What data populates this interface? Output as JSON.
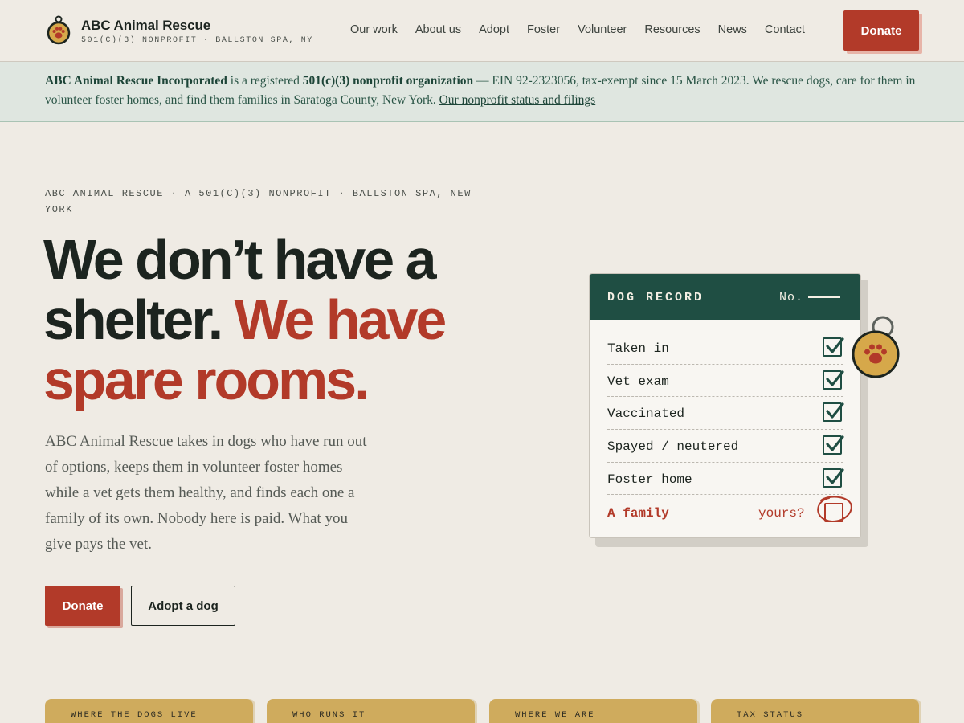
{
  "header": {
    "brand_name": "ABC Animal Rescue",
    "brand_sub": "501(C)(3) NONPROFIT · BALLSTON SPA, NY",
    "nav": [
      "Our work",
      "About us",
      "Adopt",
      "Foster",
      "Volunteer",
      "Resources",
      "News",
      "Contact"
    ],
    "donate_label": "Donate"
  },
  "notice": {
    "org_name": "ABC Animal Rescue Incorporated",
    "text_1": " is a registered ",
    "status": "501(c)(3) nonprofit organization",
    "text_2": " — EIN 92-2323056, tax-exempt since 15 March 2023. We rescue dogs, care for them in volunteer foster homes, and find them families in Saratoga County, New York. ",
    "link": "Our nonprofit status and filings"
  },
  "hero": {
    "eyebrow": "ABC ANIMAL RESCUE · A 501(C)(3) NONPROFIT · BALLSTON SPA, NEW YORK",
    "headline_1": "We don’t have a shelter. ",
    "headline_2": "We have spare rooms.",
    "lede": "ABC Animal Rescue takes in dogs who have run out of options, keeps them in volunteer foster homes while a vet gets them healthy, and finds each one a family of its own. Nobody here is paid. What you give pays the vet.",
    "primary_button": "Donate",
    "secondary_button": "Adopt a dog"
  },
  "record": {
    "title": "DOG RECORD",
    "number_label": "No.",
    "rows": [
      {
        "label": "Taken in",
        "checked": true
      },
      {
        "label": "Vet exam",
        "checked": true
      },
      {
        "label": "Vaccinated",
        "checked": true
      },
      {
        "label": "Spayed / neutered",
        "checked": true
      },
      {
        "label": "Foster home",
        "checked": true
      }
    ],
    "final_label": "A family",
    "final_hint": "yours?"
  },
  "info_cards": [
    "WHERE THE DOGS LIVE",
    "WHO RUNS IT",
    "WHERE WE ARE",
    "TAX STATUS"
  ],
  "colors": {
    "accent_red": "#b23a29",
    "dark_green": "#1f4e43",
    "background": "#efebe4",
    "notice_bg": "#dfe6e0",
    "mustard": "#cfab5d"
  },
  "icons": [
    "paw-tag-icon",
    "checkmark-icon",
    "paw-icon"
  ]
}
